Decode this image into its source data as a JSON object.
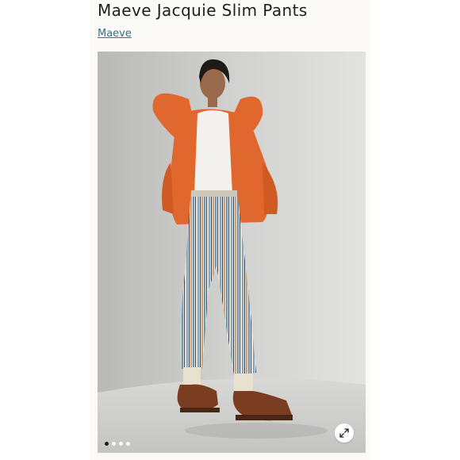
{
  "product": {
    "title": "Maeve Jacquie Slim Pants",
    "brand": "Maeve"
  },
  "gallery": {
    "image_count": 4,
    "active_index": 0,
    "zoom_icon": "expand-arrows-icon"
  },
  "colors": {
    "link": "#3a6d8c",
    "cardigan": "#e0672d",
    "shoes": "#7a3d22"
  }
}
